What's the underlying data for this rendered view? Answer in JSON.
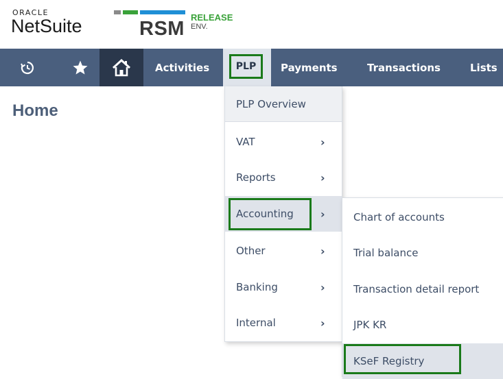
{
  "brand": {
    "oracle": "ORACLE",
    "netsuite": "NetSuite",
    "rsm": "RSM",
    "release": "RELEASE",
    "env": "ENV.",
    "bar_colors": [
      "#8a8a8a",
      "#3aa23a",
      "#1f8fd6"
    ]
  },
  "nav": {
    "recent_icon": "history-icon",
    "favorites_icon": "star-icon",
    "home_icon": "home-icon",
    "items": [
      "Activities",
      "PLP",
      "Payments",
      "Transactions",
      "Lists"
    ]
  },
  "page": {
    "title": "Home"
  },
  "plp_menu": {
    "items": [
      {
        "label": "PLP Overview",
        "has_submenu": false
      },
      {
        "label": "VAT",
        "has_submenu": true
      },
      {
        "label": "Reports",
        "has_submenu": true
      },
      {
        "label": "Accounting",
        "has_submenu": true
      },
      {
        "label": "Other",
        "has_submenu": true
      },
      {
        "label": "Banking",
        "has_submenu": true
      },
      {
        "label": "Internal",
        "has_submenu": true
      }
    ],
    "chevron": "›"
  },
  "accounting_submenu": {
    "items": [
      "Chart of accounts",
      "Trial balance",
      "Transaction detail report",
      "JPK KR",
      "KSeF Registry"
    ]
  },
  "colors": {
    "nav_bg": "#4a5f7e",
    "highlight_border": "#1a7a1a",
    "title": "#4d5f79"
  }
}
